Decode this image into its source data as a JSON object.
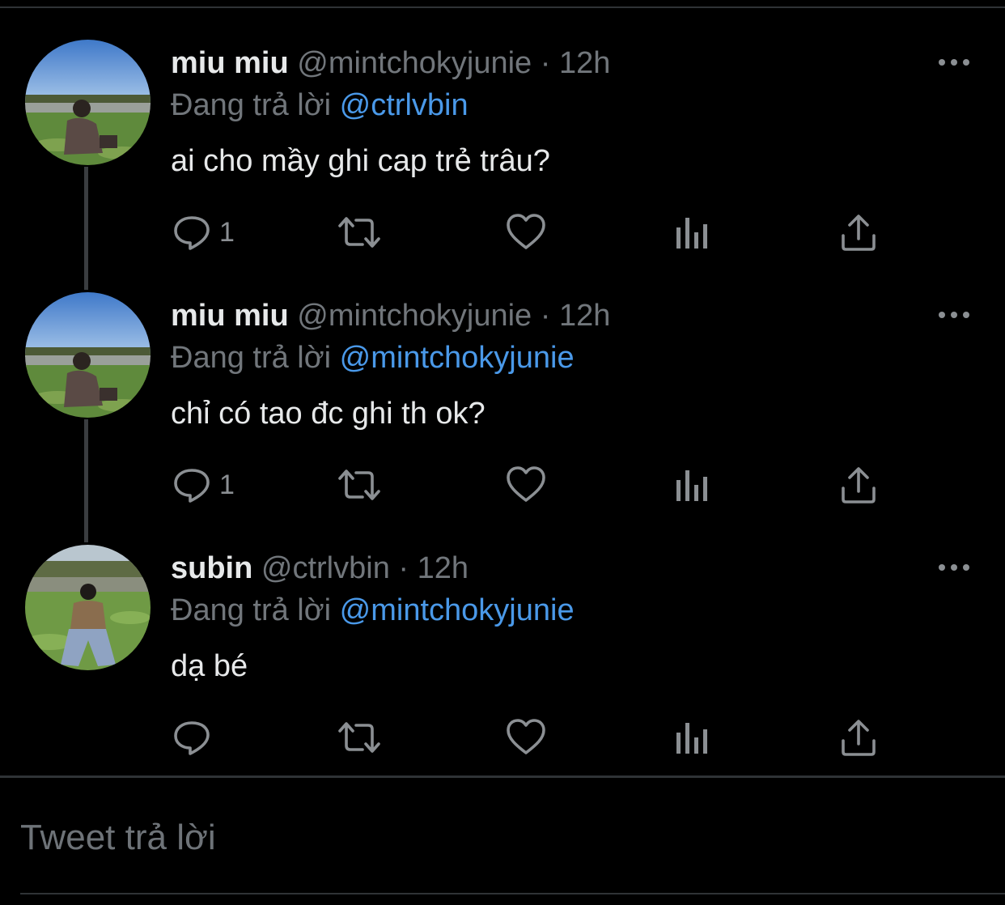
{
  "tweets": [
    {
      "display_name": "miu miu",
      "handle": "@mintchokyjunie",
      "separator": "·",
      "time": "12h",
      "reply_prefix": "Đang trả lời",
      "reply_to": "@ctrlvbin",
      "text": "ai cho mầy ghi cap trẻ trâu?",
      "reply_count": "1"
    },
    {
      "display_name": "miu miu",
      "handle": "@mintchokyjunie",
      "separator": "·",
      "time": "12h",
      "reply_prefix": "Đang trả lời",
      "reply_to": "@mintchokyjunie",
      "text": "chỉ có tao đc ghi th ok?",
      "reply_count": "1"
    },
    {
      "display_name": "subin",
      "handle": "@ctrlvbin",
      "separator": "·",
      "time": "12h",
      "reply_prefix": "Đang trả lời",
      "reply_to": "@mintchokyjunie",
      "text": "dạ bé",
      "reply_count": ""
    }
  ],
  "compose": {
    "placeholder": "Tweet trả lời"
  },
  "icons": {
    "more": "more-dots-icon",
    "reply": "reply-bubble-icon",
    "retweet": "retweet-icon",
    "like": "heart-icon",
    "analytics": "analytics-bars-icon",
    "share": "share-upload-icon"
  },
  "colors": {
    "background": "#000000",
    "text": "#e7e9ea",
    "muted": "#71767b",
    "mention": "#4a99e9",
    "divider": "#2f3336"
  }
}
